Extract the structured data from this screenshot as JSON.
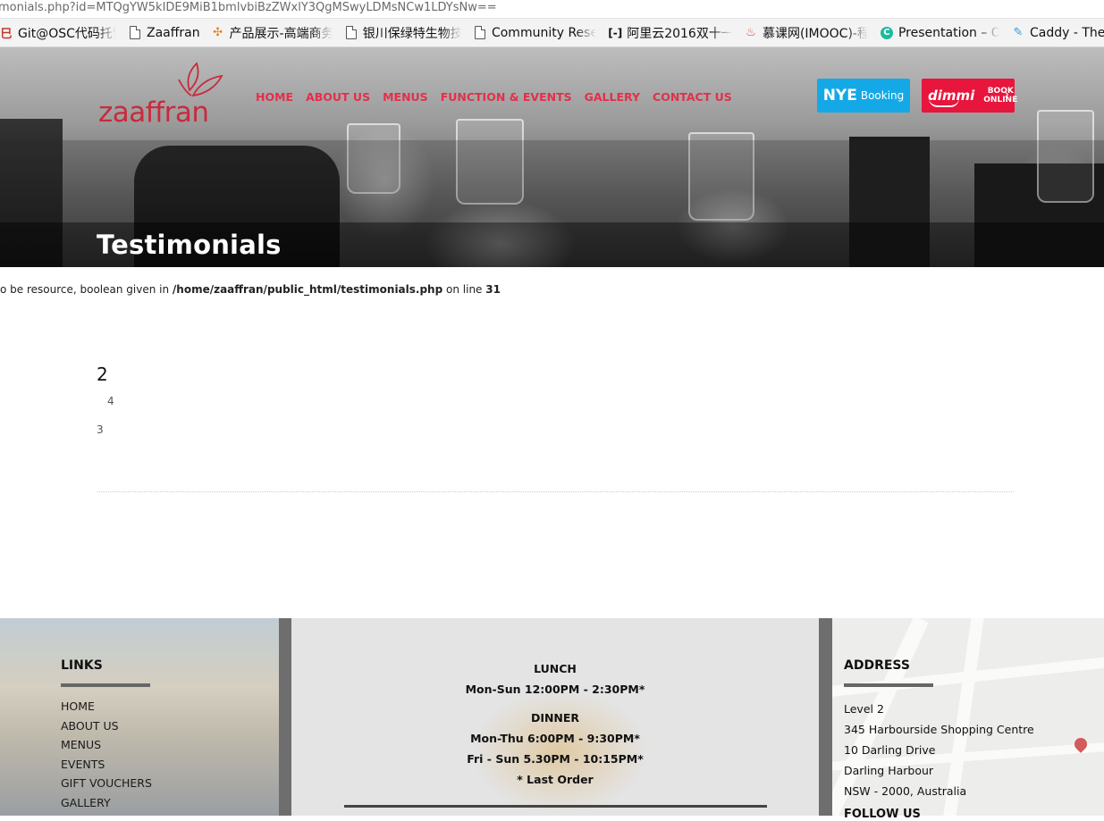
{
  "browser": {
    "url": "monials.php?id=MTQgYW5kIDE9MiB1bmlvbiBzZWxlY3QgMSwyLDMsNCw1LDYsNw==",
    "bookmarks": [
      {
        "label": "Git@OSC代码托管",
        "icon": "osc-icon"
      },
      {
        "label": "Zaaffran",
        "icon": "page-icon"
      },
      {
        "label": "产品展示-高端商务",
        "icon": "pinwheel-icon"
      },
      {
        "label": "银川保绿特生物技",
        "icon": "page-icon"
      },
      {
        "label": "Community Rese",
        "icon": "page-icon"
      },
      {
        "label": "阿里云2016双十一",
        "icon": "aliyun-icon"
      },
      {
        "label": "慕课网(IMOOC)-程",
        "icon": "flame-icon"
      },
      {
        "label": "Presentation – O",
        "icon": "c-circle-icon"
      },
      {
        "label": "Caddy - The",
        "icon": "feather-icon"
      }
    ]
  },
  "site": {
    "logo": "zaaffran",
    "nav": [
      "HOME",
      "ABOUT US",
      "MENUS",
      "FUNCTION & EVENTS",
      "GALLERY",
      "CONTACT US"
    ],
    "nye_button": {
      "big": "NYE",
      "small": "Booking"
    },
    "dimmi_button": {
      "brand": "dimmi",
      "book_line1": "BOOK",
      "book_line2": "ONLINE"
    },
    "page_title": "Testimonials",
    "accent_color": "#e2304a",
    "nye_color": "#14a9e6",
    "dimmi_color": "#e8153c"
  },
  "content": {
    "warning_prefix": "o be resource, boolean given in ",
    "warning_path": "/home/zaaffran/public_html/testimonials.php",
    "warning_mid": " on line ",
    "warning_line": "31",
    "value_2": "2",
    "value_4": "4",
    "value_3": "3"
  },
  "footer": {
    "links_heading": "LINKS",
    "links": [
      "HOME",
      "ABOUT US",
      "MENUS",
      "EVENTS",
      "GIFT VOUCHERS",
      "GALLERY"
    ],
    "lunch_heading": "LUNCH",
    "lunch_hours": "Mon-Sun 12:00PM - 2:30PM*",
    "dinner_heading": "DINNER",
    "dinner_hours_1": "Mon-Thu 6:00PM - 9:30PM*",
    "dinner_hours_2": "Fri - Sun 5.30PM - 10:15PM*",
    "last_order": "* Last Order",
    "address_heading": "ADDRESS",
    "address_lines": [
      "Level 2",
      "345 Harbourside Shopping Centre",
      "10 Darling Drive",
      "Darling Harbour",
      "NSW - 2000,  Australia"
    ],
    "follow_heading": "FOLLOW US"
  }
}
